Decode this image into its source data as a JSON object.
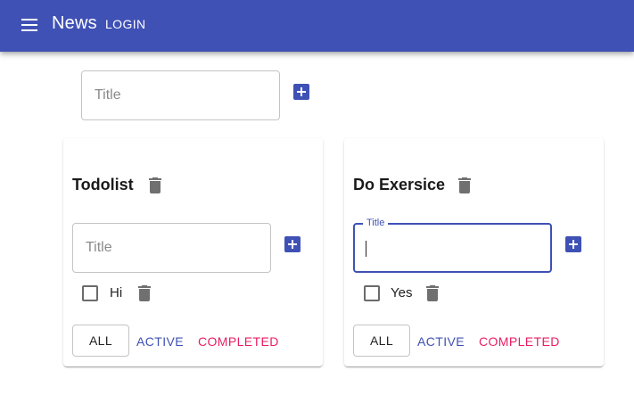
{
  "appbar": {
    "menu_icon": "menu-icon",
    "title": "News",
    "login_label": "LOGIN"
  },
  "new_list": {
    "placeholder": "Title",
    "add_icon": "add-box-icon"
  },
  "todolists": [
    {
      "title": "Todolist",
      "input": {
        "placeholder": "Title",
        "focused": false,
        "value": ""
      },
      "tasks": [
        {
          "label": "Hi",
          "checked": false
        }
      ],
      "filters": {
        "all": "ALL",
        "active": "ACTIVE",
        "completed": "COMPLETED"
      }
    },
    {
      "title": "Do Exersice",
      "input": {
        "label": "Title",
        "focused": true,
        "value": ""
      },
      "tasks": [
        {
          "label": "Yes",
          "checked": false
        }
      ],
      "filters": {
        "all": "ALL",
        "active": "ACTIVE",
        "completed": "COMPLETED"
      }
    }
  ],
  "colors": {
    "primary": "#3f51b5",
    "secondary": "#e91e63",
    "icon_gray": "#707070"
  }
}
